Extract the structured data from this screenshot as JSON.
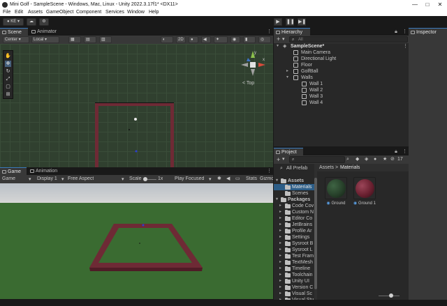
{
  "window": {
    "title": "Mini Golf - SampleScene - Windows, Mac, Linux - Unity 2022.3.17f1* <DX11>",
    "minimize": "—",
    "maximize": "□",
    "close": "✕"
  },
  "menu": [
    "File",
    "Edit",
    "Assets",
    "GameObject",
    "Component",
    "Services",
    "Window",
    "Help"
  ],
  "toolbar": {
    "account": "KE",
    "play": "▶",
    "pause": "❚❚",
    "step": "▶❚"
  },
  "scene": {
    "tabs": [
      "Scene",
      "Animator"
    ],
    "pivot_mode": "Center",
    "pivot_space": "Local",
    "mode_2d": "2D",
    "gizmo_label": "< Top",
    "gizmo_axes": {
      "y": "y",
      "x": "x",
      "z": "z"
    }
  },
  "game": {
    "tabs": [
      "Game",
      "Animation"
    ],
    "display_type": "Game",
    "display": "Display 1",
    "aspect": "Free Aspect",
    "scale_label": "Scale",
    "scale_value": "1x",
    "play_mode": "Play Focused",
    "stats": "Stats",
    "gizmos": "Gizmo"
  },
  "hierarchy": {
    "tab": "Hierarchy",
    "search_placeholder": "All",
    "scene": "SampleScene*",
    "items": [
      {
        "label": "Main Camera"
      },
      {
        "label": "Directional Light"
      },
      {
        "label": "Floor"
      },
      {
        "label": "GolfBall"
      },
      {
        "label": "Walls"
      },
      {
        "label": "Wall 1"
      },
      {
        "label": "Wall 2"
      },
      {
        "label": "Wall 3"
      },
      {
        "label": "Wall 4"
      }
    ]
  },
  "inspector": {
    "tab": "Inspector"
  },
  "project": {
    "tab": "Project",
    "hidden_count": "17",
    "favorites": [
      "All Prefab"
    ],
    "assets_root": "Assets",
    "assets_children": [
      "Materials",
      "Scenes"
    ],
    "packages_root": "Packages",
    "packages": [
      "Code Cov",
      "Custom N",
      "Editor Co",
      "JetBrains",
      "Profile Ar",
      "Settings",
      "Sysroot B",
      "Sysroot L",
      "Test Fram",
      "TextMesh",
      "Timeline",
      "Toolchain",
      "Unity UI",
      "Version C",
      "Visual Sc",
      "Visual Stu"
    ],
    "breadcrumb": [
      "Assets",
      "Materials"
    ],
    "breadcrumb_sep": ">",
    "materials": [
      {
        "label": "Ground",
        "color": "#27402a"
      },
      {
        "label": "Ground 1",
        "color": "#6a2030"
      }
    ]
  },
  "colors": {
    "accent": "#3a79bb",
    "wall": "#6e2a35",
    "grid_green": "#30402f",
    "game_ground": "#3a6b31"
  }
}
